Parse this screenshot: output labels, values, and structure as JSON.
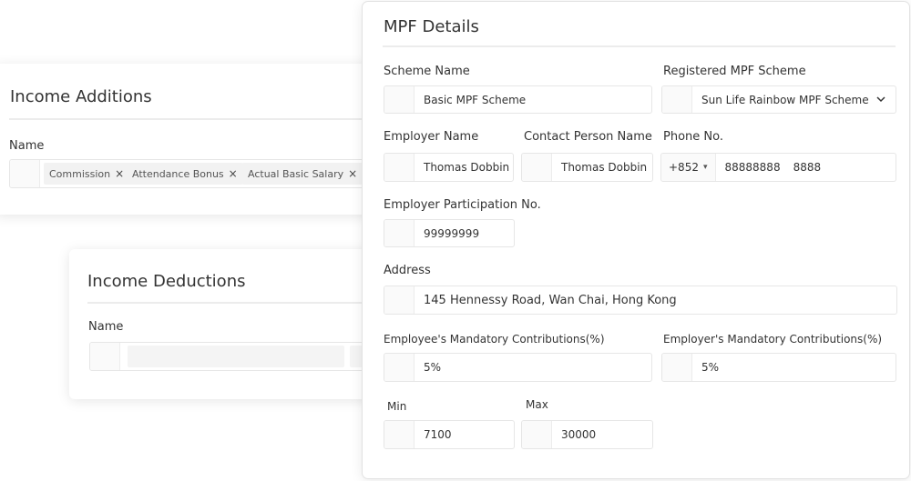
{
  "income_additions": {
    "title": "Income Additions",
    "name_label": "Name",
    "tags": [
      {
        "label": "Commission"
      },
      {
        "label": "Attendance Bonus"
      },
      {
        "label": "Actual Basic Salary"
      }
    ]
  },
  "income_deductions": {
    "title": "Income Deductions",
    "name_label": "Name"
  },
  "mpf": {
    "title": "MPF Details",
    "scheme_name": {
      "label": "Scheme Name",
      "value": "Basic MPF Scheme"
    },
    "registered_scheme": {
      "label": "Registered MPF Scheme",
      "value": "Sun Life Rainbow MPF Scheme"
    },
    "employer_name": {
      "label": "Employer Name",
      "value": "Thomas Dobbin"
    },
    "contact_person": {
      "label": "Contact Person Name",
      "value": "Thomas Dobbin"
    },
    "phone": {
      "label": "Phone No.",
      "country_code": "+852",
      "number": "88888888",
      "extension": "8888"
    },
    "participation_no": {
      "label": "Employer Participation No.",
      "value": "99999999"
    },
    "address": {
      "label": "Address",
      "value": "145 Hennessy Road, Wan Chai, Hong Kong"
    },
    "employee_contrib": {
      "label": "Employee's Mandatory Contributions(%)",
      "value": "5%"
    },
    "employer_contrib": {
      "label": "Employer's Mandatory Contributions(%)",
      "value": "5%"
    },
    "min": {
      "label": "Min",
      "value": "7100"
    },
    "max": {
      "label": "Max",
      "value": "30000"
    }
  }
}
